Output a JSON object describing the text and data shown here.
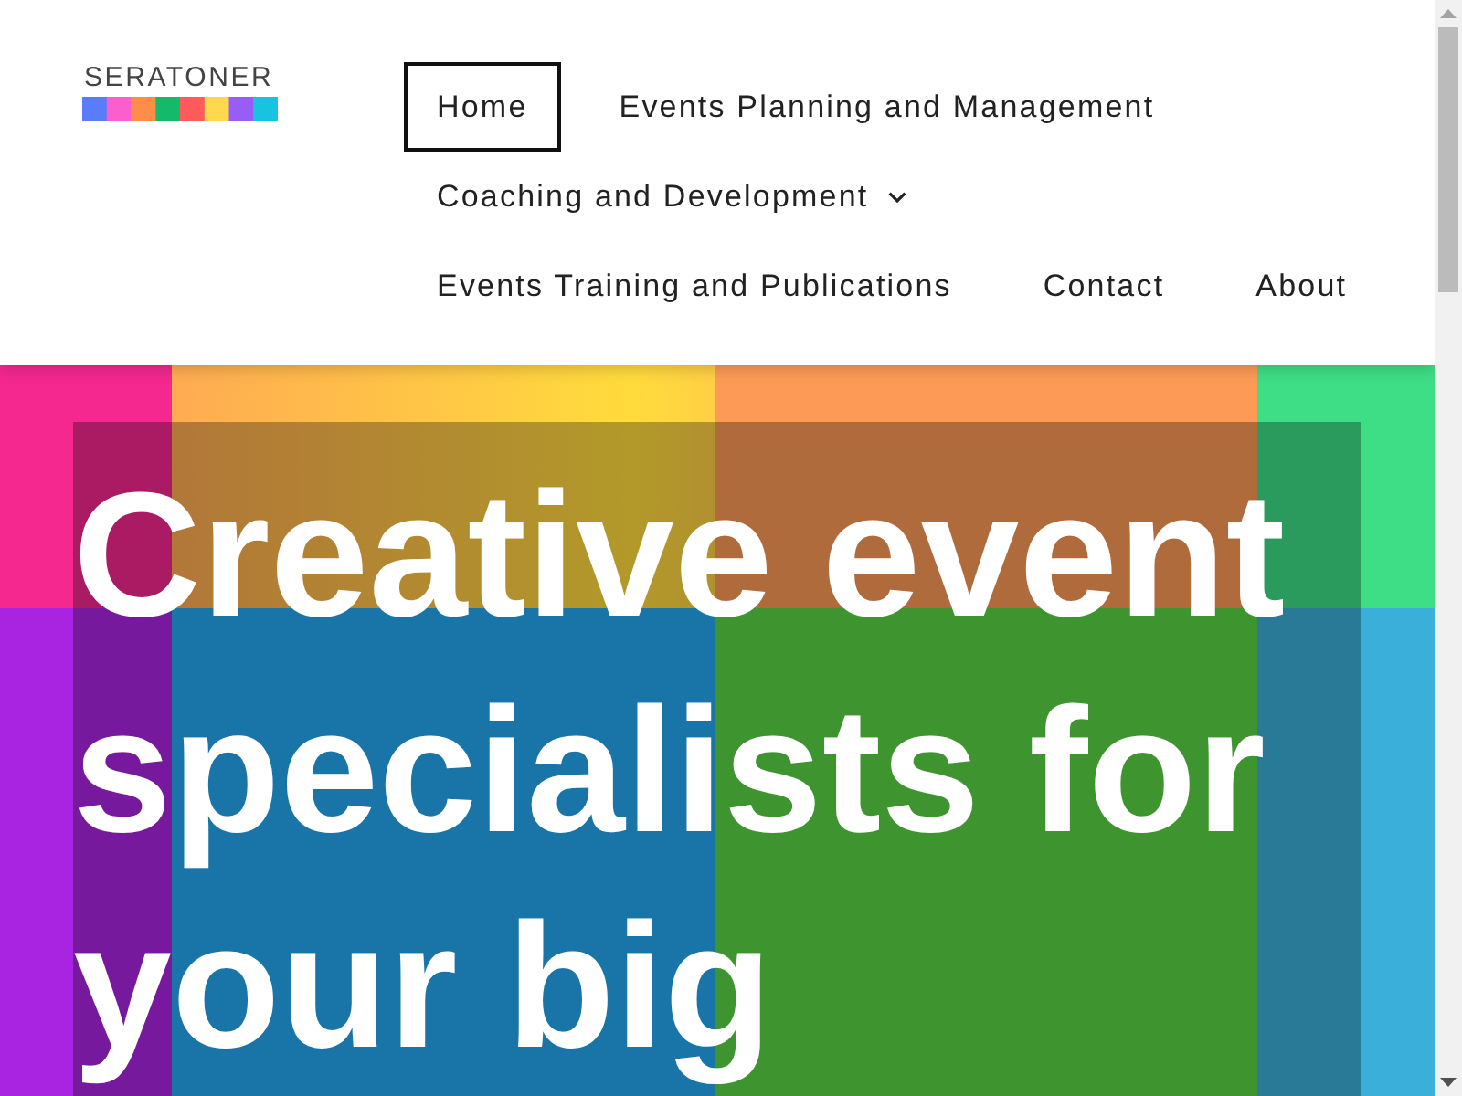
{
  "logo": {
    "text": "SERATONER"
  },
  "nav": {
    "items": [
      {
        "label": "Home",
        "selected": true,
        "has_submenu": false
      },
      {
        "label": "Events Planning and Management",
        "selected": false,
        "has_submenu": false
      },
      {
        "label": "Coaching and Development",
        "selected": false,
        "has_submenu": true
      },
      {
        "label": "Events Training and Publications",
        "selected": false,
        "has_submenu": false
      },
      {
        "label": "Contact",
        "selected": false,
        "has_submenu": false
      },
      {
        "label": "About",
        "selected": false,
        "has_submenu": false
      }
    ]
  },
  "hero": {
    "heading": "Creative event specialists for your big"
  }
}
